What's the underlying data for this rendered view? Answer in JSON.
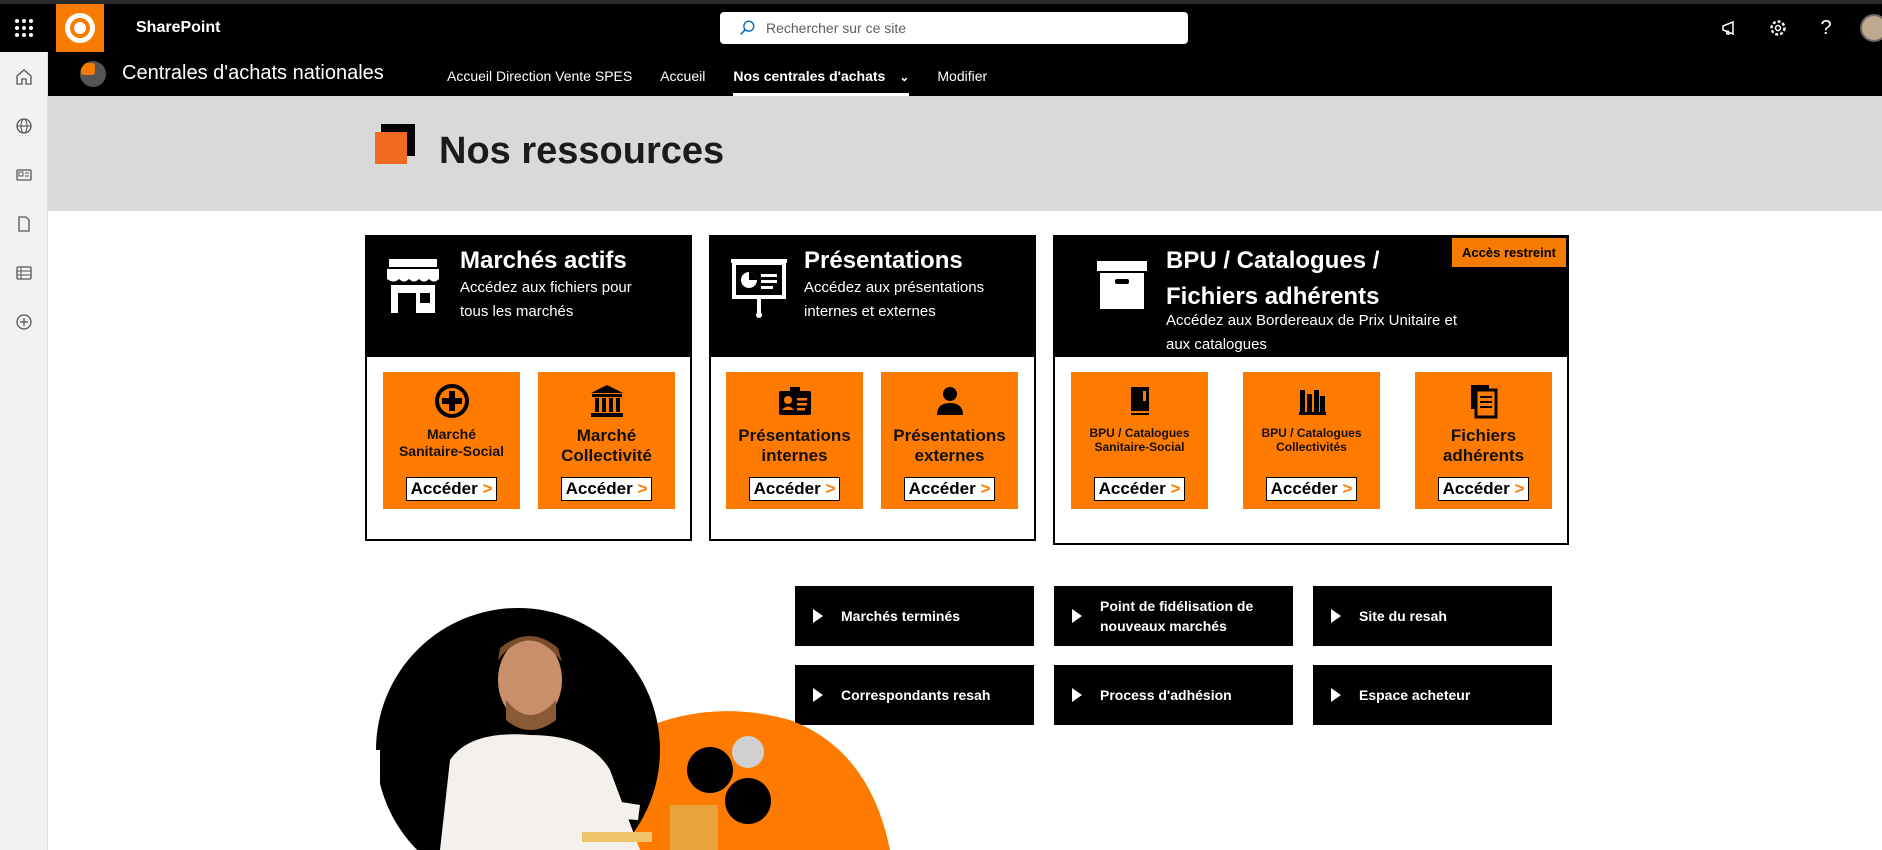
{
  "topbar": {
    "app_name": "SharePoint",
    "search_placeholder": "Rechercher sur ce site"
  },
  "site": {
    "title": "Centrales d'achats nationales",
    "nav": [
      {
        "label": "Accueil Direction Vente SPES"
      },
      {
        "label": "Accueil"
      },
      {
        "label": "Nos centrales d'achats",
        "active": true,
        "has_dropdown": true
      },
      {
        "label": "Modifier"
      }
    ]
  },
  "banner": {
    "title": "Nos ressources"
  },
  "cards": [
    {
      "title": "Marchés actifs",
      "subtitle_line1": "Accédez aux fichiers pour",
      "subtitle_line2": "tous les marchés",
      "icon": "storefront-icon",
      "tiles": [
        {
          "label_line1": "Marché",
          "label_line2": "Sanitaire-Social",
          "icon": "plus-circle-icon",
          "button": "Accéder"
        },
        {
          "label_line1": "Marché",
          "label_line2": "Collectivité",
          "icon": "bank-icon",
          "button": "Accéder"
        }
      ]
    },
    {
      "title": "Présentations",
      "subtitle_line1": "Accédez aux présentations",
      "subtitle_line2": "internes et externes",
      "icon": "presentation-board-icon",
      "tiles": [
        {
          "label_line1": "Présentations",
          "label_line2": "internes",
          "icon": "id-card-icon",
          "button": "Accéder"
        },
        {
          "label_line1": "Présentations",
          "label_line2": "externes",
          "icon": "person-icon",
          "button": "Accéder"
        }
      ]
    },
    {
      "title_line1": "BPU / Catalogues /",
      "title_line2": "Fichiers adhérents",
      "subtitle_line1": "Accédez aux Bordereaux de Prix Unitaire et",
      "subtitle_line2": "aux catalogues",
      "badge": "Accès restreint",
      "icon": "archive-box-icon",
      "tiles": [
        {
          "label_line1": "BPU / Catalogues",
          "label_line2": "Sanitaire-Social",
          "icon": "book-icon",
          "button": "Accéder"
        },
        {
          "label_line1": "BPU / Catalogues",
          "label_line2": "Collectivités",
          "icon": "books-icon",
          "button": "Accéder"
        },
        {
          "label_line1": "Fichiers",
          "label_line2": "adhérents",
          "icon": "documents-icon",
          "button": "Accéder"
        }
      ]
    }
  ],
  "quick_links": [
    {
      "line1": "Marchés terminés",
      "line2": ""
    },
    {
      "line1": "Point de fidélisation de",
      "line2": "nouveaux marchés"
    },
    {
      "line1": "Site du resah",
      "line2": ""
    },
    {
      "line1": "Correspondants resah",
      "line2": ""
    },
    {
      "line1": "Process d'adhésion",
      "line2": ""
    },
    {
      "line1": "Espace acheteur",
      "line2": ""
    }
  ],
  "colors": {
    "accent_orange": "#ff7b00",
    "black": "#000000",
    "banner_grey": "#d9d9d9"
  }
}
